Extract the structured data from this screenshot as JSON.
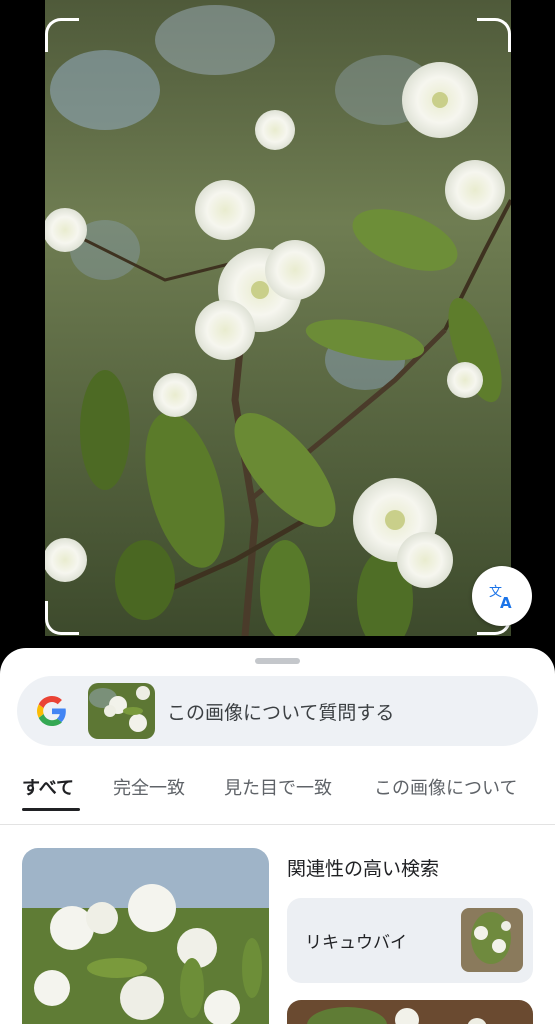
{
  "search": {
    "prompt": "この画像について質問する",
    "logo_icon": "google-g-logo"
  },
  "tabs": [
    {
      "label": "すべて",
      "active": true
    },
    {
      "label": "完全一致",
      "active": false
    },
    {
      "label": "見た目で一致",
      "active": false
    },
    {
      "label": "この画像について",
      "active": false
    }
  ],
  "related": {
    "title": "関連性の高い検索",
    "items": [
      {
        "label": "リキュウバイ"
      }
    ]
  },
  "icons": {
    "translate": "translate-icon"
  },
  "colors": {
    "sheet_bg": "#ffffff",
    "search_bg": "#eef1f5",
    "google_blue": "#4285F4",
    "google_red": "#EA4335",
    "google_yellow": "#FBBC05",
    "google_green": "#34A853"
  }
}
